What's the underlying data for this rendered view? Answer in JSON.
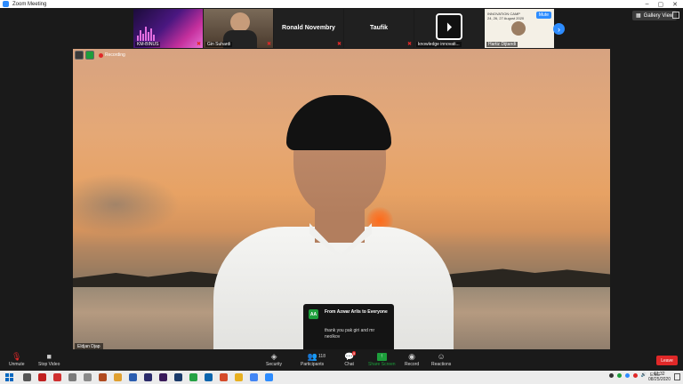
{
  "window": {
    "title": "Zoom Meeting",
    "controls": [
      "–",
      "▢",
      "✕"
    ]
  },
  "gallery_strip": [
    {
      "name": "KM-BINUS",
      "muted": true
    },
    {
      "name": "Gin Suhardi",
      "muted": true
    },
    {
      "name": "Ronald Novembry",
      "muted": true
    },
    {
      "name": "Taufik",
      "muted": true
    },
    {
      "name": "knowledge innovati...",
      "muted": false
    },
    {
      "name": "Hartiz Dijtandi",
      "muted": false,
      "tag": "Mute"
    }
  ],
  "gallery_view_label": "Gallery View",
  "recording_label": "Recording",
  "active_speaker": "Eldjan Djap",
  "chat_popup": {
    "avatar": "AA",
    "from": "From Azwar Arlis to Everyone",
    "message": "thank you pak giri and mr neolkov"
  },
  "toolbar": {
    "unmute": "Unmute",
    "stop_video": "Stop Video",
    "security": "Security",
    "participants": "Participants",
    "participants_count": "118",
    "chat": "Chat",
    "chat_badge": "5",
    "share_screen": "Share Screen",
    "record": "Record",
    "reactions": "Reactions",
    "leave": "Leave"
  },
  "taskbar": {
    "language": "ENG",
    "time": "11:32",
    "date": "08/25/2020"
  },
  "colors": {
    "accent": "#2d8cff",
    "share_green": "#1d9e3b",
    "danger": "#e02828"
  }
}
